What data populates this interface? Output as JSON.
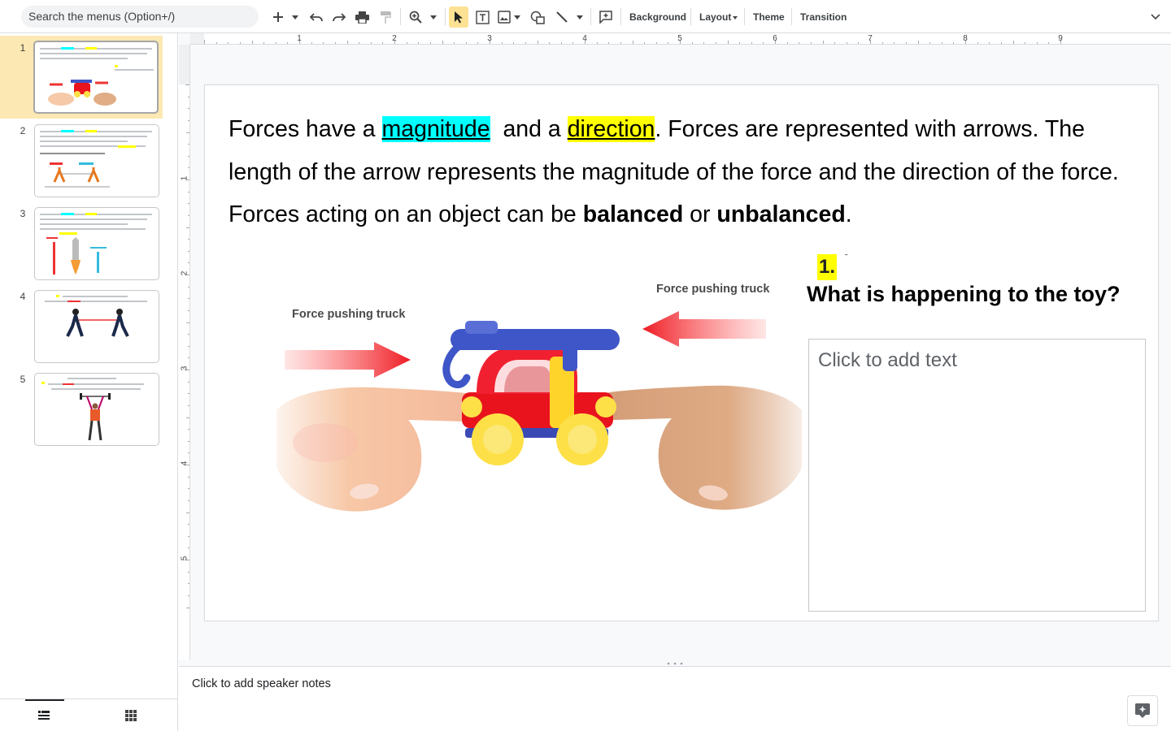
{
  "toolbar": {
    "search_placeholder": "Search the menus (Option+/)",
    "background_label": "Background",
    "layout_label": "Layout",
    "theme_label": "Theme",
    "transition_label": "Transition"
  },
  "filmstrip": {
    "slides": [
      {
        "number": "1",
        "selected": true
      },
      {
        "number": "2",
        "selected": false
      },
      {
        "number": "3",
        "selected": false
      },
      {
        "number": "4",
        "selected": false
      },
      {
        "number": "5",
        "selected": false
      }
    ]
  },
  "rulers": {
    "horizontal": [
      "1",
      "2",
      "3",
      "4",
      "5",
      "6",
      "7",
      "8",
      "9"
    ],
    "vertical": [
      "1",
      "2",
      "3",
      "4",
      "5"
    ]
  },
  "slide": {
    "text": {
      "p1": "Forces have a ",
      "magnitude": "magnitude",
      "p2": "  and a ",
      "direction": "direction",
      "p3": ". Forces are represented with arrows. The length of the arrow represents the magnitude of the force and the direction of the force. Forces acting on an object can be ",
      "balanced": "balanced",
      "p4": " or ",
      "unbalanced": "unbalanced",
      "p5": "."
    },
    "question_number": "1.",
    "question_dot": "˜",
    "question_text": "What is happening to the toy?",
    "answer_placeholder": "Click to add text",
    "illustration": {
      "label_left": "Force pushing truck",
      "label_right": "Force pushing truck"
    },
    "colors": {
      "highlight_cyan": "#00ffff",
      "highlight_yellow": "#ffff00",
      "selected_slide": "#fce8b2"
    }
  },
  "notes": {
    "placeholder": "Click to add speaker notes"
  }
}
